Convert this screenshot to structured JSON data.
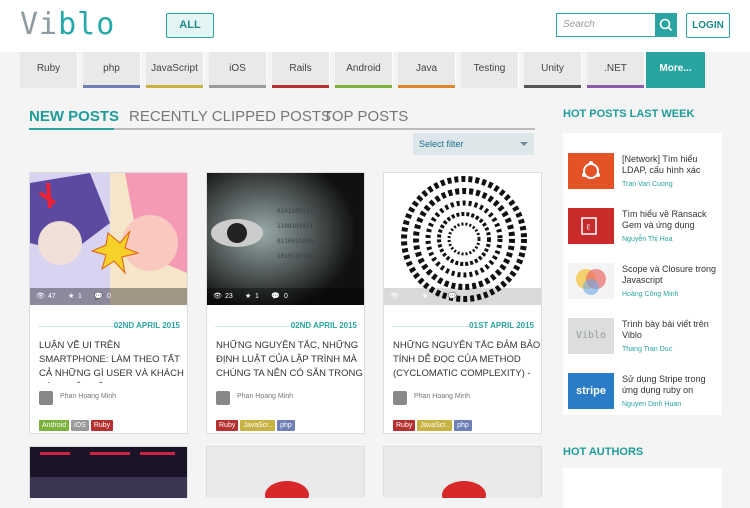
{
  "header": {
    "logo_part1": "Vi",
    "logo_part2": "blo",
    "all_button": "ALL",
    "search_placeholder": "Search",
    "login_button": "LOGIN"
  },
  "tags": [
    {
      "label": "Ruby",
      "color": "#e9e9e9"
    },
    {
      "label": "php",
      "color": "#6e7fb6"
    },
    {
      "label": "JavaScript",
      "color": "#c8b242"
    },
    {
      "label": "iOS",
      "color": "#9a9a9a"
    },
    {
      "label": "Rails",
      "color": "#b73030"
    },
    {
      "label": "Android",
      "color": "#7ab23c"
    },
    {
      "label": "Java",
      "color": "#e1872b"
    },
    {
      "label": "Testing",
      "color": "#e9e9e9"
    },
    {
      "label": "Unity",
      "color": "#555555"
    },
    {
      "label": ".NET",
      "color": "#8b5da8"
    },
    {
      "label": "More...",
      "color": "#2aa4a0"
    }
  ],
  "main_tabs": {
    "new": "NEW POSTS",
    "clipped": "RECENTLY CLIPPED POSTS",
    "top": "TOP POSTS"
  },
  "filter": {
    "label": "Select filter"
  },
  "posts": [
    {
      "date": "02ND APRIL 2015",
      "title": "LUẬN VỀ UI TRÊN SMARTPHONE: LÀM THEO TẤT CẢ NHỮNG GÌ USER VÀ KHÁCH HÀNG YÊU CẦU,",
      "author": "Phan Hoang Minh",
      "views": "47",
      "clips": "1",
      "comments": "0",
      "labels": [
        {
          "text": "Android",
          "cls": "android"
        },
        {
          "text": "iOS",
          "cls": "ios"
        },
        {
          "text": "Ruby",
          "cls": "ruby"
        }
      ]
    },
    {
      "date": "02ND APRIL 2015",
      "title": "NHỮNG NGUYÊN TẮC, NHỮNG ĐỊNH LUẬT CỦA LẬP TRÌNH MÀ CHÚNG TA NÊN CÓ SẴN TRONG",
      "author": "Phan Hoang Minh",
      "views": "23",
      "clips": "1",
      "comments": "0",
      "labels": [
        {
          "text": "Ruby",
          "cls": "ruby"
        },
        {
          "text": "JavaScr..",
          "cls": "js"
        },
        {
          "text": "php",
          "cls": "php"
        }
      ]
    },
    {
      "date": "01ST APRIL 2015",
      "title": "NHỮNG NGUYÊN TẮC ĐẢM BẢO TÍNH DỄ ĐỌC CỦA METHOD (CYCLOMATIC COMPLEXITY) -",
      "author": "Phan Hoang Minh",
      "views": "",
      "clips": "",
      "comments": "",
      "labels": [
        {
          "text": "Ruby",
          "cls": "ruby"
        },
        {
          "text": "JavaScr..",
          "cls": "js"
        },
        {
          "text": "php",
          "cls": "php"
        }
      ]
    }
  ],
  "sidebar": {
    "hot_posts_title": "HOT POSTS LAST WEEK",
    "hot_posts": [
      {
        "title": "[Network] Tìm hiểu LDAP, cấu hình xác",
        "author": "Tran Van Cuong",
        "thumb_color": "#e45325",
        "icon": "ubuntu-icon"
      },
      {
        "title": "Tìm hiểu về Ransack Gem và ứng dụng",
        "author": "Nguyễn Thị Hoa",
        "thumb_color": "#c92a2a",
        "icon": "ruby-icon"
      },
      {
        "title": "Scope và Closure trong Javascript",
        "author": "Hoàng Công Minh",
        "thumb_color": "#f4f4f4",
        "icon": "venn-icon"
      },
      {
        "title": "Trình bày bài viết trên Viblo",
        "author": "Thang Tran Duc",
        "thumb_color": "#dddddd",
        "icon": "viblo-icon"
      },
      {
        "title": "Sử dụng Stripe trong ứng dụng ruby on",
        "author": "Nguyen Dinh Huan",
        "thumb_color": "#2a7cc7",
        "icon": "stripe-icon"
      }
    ],
    "hot_authors_title": "HOT AUTHORS",
    "viblo_thumb_text": "Viblo",
    "stripe_thumb_text": "stripe"
  }
}
